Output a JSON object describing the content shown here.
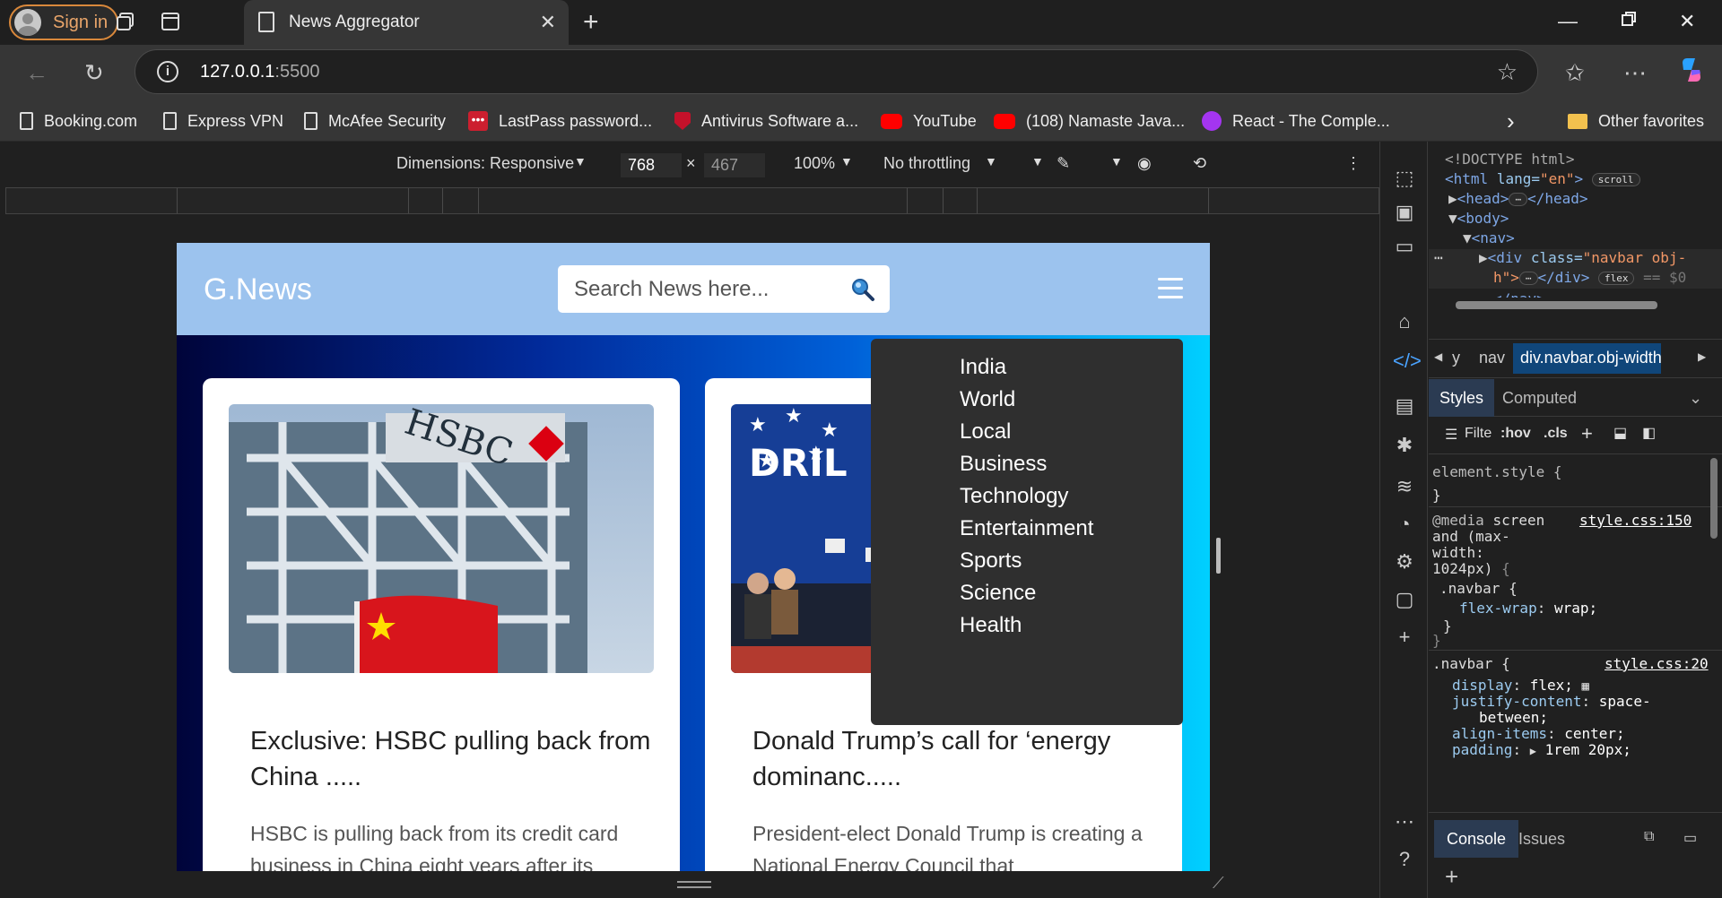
{
  "browser": {
    "signin_label": "Sign in",
    "tab_title": "News Aggregator",
    "url_host": "127.0.0.1",
    "url_port": ":5500",
    "bookmarks": [
      "Booking.com",
      "Express VPN",
      "McAfee Security",
      "LastPass password...",
      "Antivirus Software a...",
      "YouTube",
      "(108) Namaste Java...",
      "React - The Comple..."
    ],
    "other_favorites": "Other favorites"
  },
  "devtools_toolbar": {
    "dimensions": "Dimensions: Responsive",
    "width": "768",
    "height": "467",
    "zoom": "100%",
    "throttling": "No throttling"
  },
  "page": {
    "logo": "G.News",
    "search_placeholder": "Search News here...",
    "menu": [
      "India",
      "World",
      "Local",
      "Business",
      "Technology",
      "Entertainment",
      "Sports",
      "Science",
      "Health"
    ],
    "cards": [
      {
        "title": "Exclusive: HSBC pulling back from China .....",
        "desc": "HSBC is pulling back from its credit card business in China eight years after its"
      },
      {
        "title": "Donald Trump’s call for ‘energy dominanc.....",
        "desc": "President-elect Donald Trump is creating a National Energy Council that"
      }
    ]
  },
  "devtools": {
    "dom": {
      "doctype": "<!DOCTYPE html>",
      "html_open": "<html",
      "lang_attr": "lang=",
      "lang_val": "\"en\"",
      "html_close": ">",
      "scroll_badge": "scroll",
      "head": "<head>",
      "head_close": "</head>",
      "ellipsis": "⋯",
      "body": "<body>",
      "nav": "<nav>",
      "div_open": "<div",
      "class_attr": "class=",
      "class_val": "\"navbar obj-",
      "class_val2": "h\">",
      "div_close": "</div>",
      "flex_badge": "flex",
      "eq_hint": "== $0",
      "nav_close": "</nav>"
    },
    "breadcrumbs": [
      "y",
      "nav",
      "div.navbar.obj-width"
    ],
    "style_tabs": [
      "Styles",
      "Computed"
    ],
    "filter": "Filte",
    "hov": ":hov",
    "cls": ".cls",
    "styles": {
      "element_style": "element.style {",
      "close_brace": "}",
      "media_kw": "@media",
      "media_1": "screen",
      "media_2": "and (max-",
      "media_3": "width:",
      "media_4": "1024px)",
      "media_4b": "{",
      "media_src": "style.css:150",
      "navbar_sel": ".navbar {",
      "flex_wrap_prop": "flex-wrap",
      "flex_wrap_val": "wrap;",
      "colon": ":",
      "navbar2_src": "style.css:20",
      "display_prop": "display",
      "display_val": "flex;",
      "jc_prop": "justify-content",
      "jc_val": "space-",
      "jc_val2": "between;",
      "ai_prop": "align-items",
      "ai_val": "center;",
      "pad_prop": "padding",
      "pad_val": "1rem 20px;"
    },
    "drawer_tabs": [
      "Console",
      "Issues"
    ]
  },
  "colors": {
    "navbar": "#9cc3ee",
    "accent_signin": "#d9883b",
    "dropdown": "#2f2f2f"
  }
}
